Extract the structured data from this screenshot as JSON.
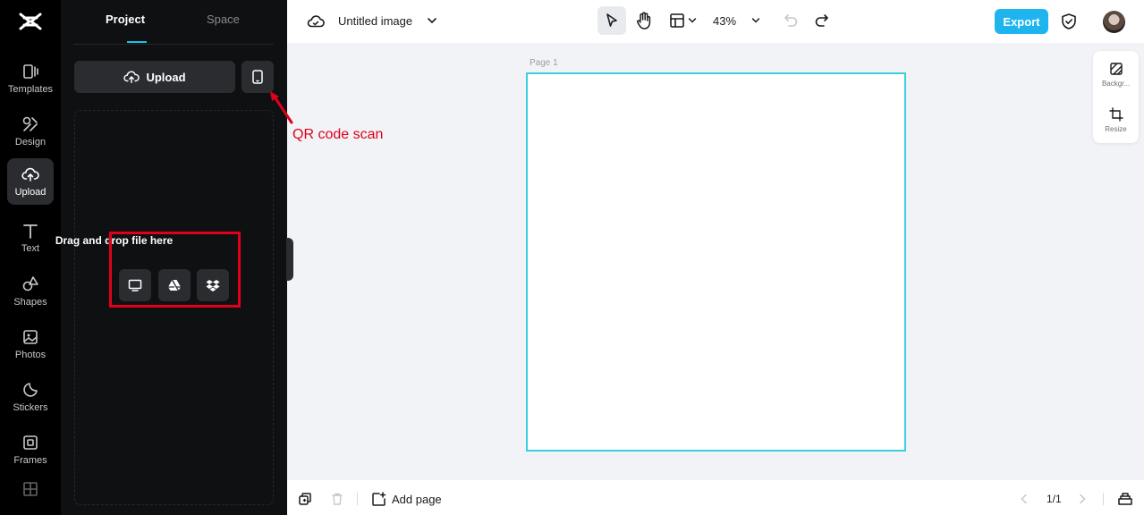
{
  "sidebar": {
    "items": [
      {
        "label": "Templates",
        "icon": "templates-icon"
      },
      {
        "label": "Design",
        "icon": "design-icon"
      },
      {
        "label": "Upload",
        "icon": "upload-cloud-icon",
        "active": true
      },
      {
        "label": "Text",
        "icon": "text-icon"
      },
      {
        "label": "Shapes",
        "icon": "shapes-icon"
      },
      {
        "label": "Photos",
        "icon": "photos-icon"
      },
      {
        "label": "Stickers",
        "icon": "stickers-icon"
      },
      {
        "label": "Frames",
        "icon": "frames-icon"
      }
    ]
  },
  "panel": {
    "tabs": [
      {
        "label": "Project",
        "active": true
      },
      {
        "label": "Space"
      }
    ],
    "upload_label": "Upload",
    "drop_text": "Drag and drop file here",
    "sources": [
      "computer-icon",
      "google-drive-icon",
      "dropbox-icon"
    ]
  },
  "annotation": {
    "text": "QR code scan",
    "color": "#e0001b"
  },
  "header": {
    "title": "Untitled image",
    "zoom": "43%",
    "export_label": "Export"
  },
  "canvas": {
    "page_label": "Page 1",
    "border_color": "#3ccfe0"
  },
  "float_panel": {
    "background_label": "Backgr...",
    "resize_label": "Resize"
  },
  "footer": {
    "add_page_label": "Add page",
    "page_indicator": "1/1"
  },
  "colors": {
    "accent": "#1eb5ee",
    "annotation": "#e0001b",
    "rail_bg": "#000000",
    "panel_bg": "#0f1012"
  }
}
